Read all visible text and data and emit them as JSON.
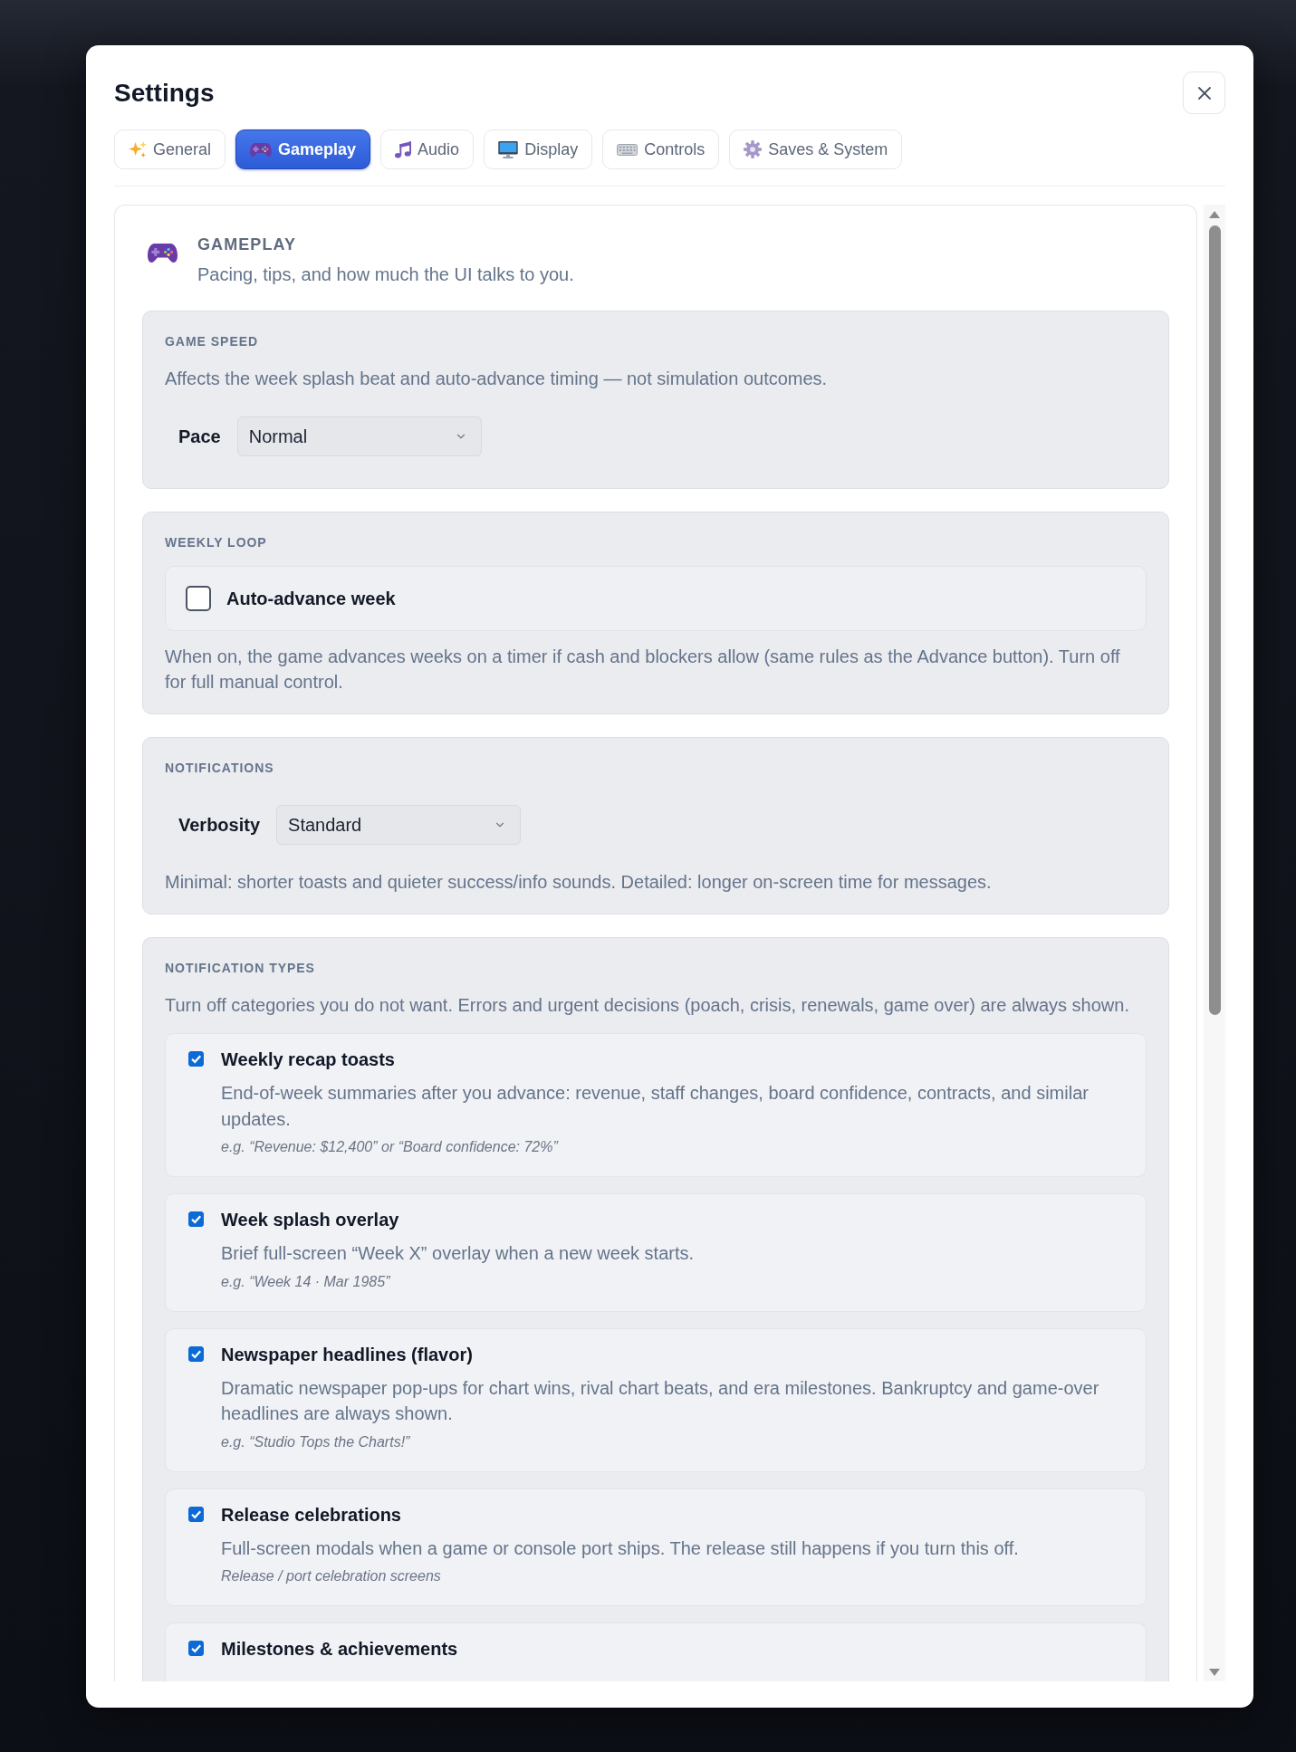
{
  "window": {
    "title": "Settings"
  },
  "tabs": [
    {
      "label": "General",
      "selected": false
    },
    {
      "label": "Gameplay",
      "selected": true
    },
    {
      "label": "Audio",
      "selected": false
    },
    {
      "label": "Display",
      "selected": false
    },
    {
      "label": "Controls",
      "selected": false
    },
    {
      "label": "Saves & System",
      "selected": false
    }
  ],
  "panel": {
    "title": "GAMEPLAY",
    "subtitle": "Pacing, tips, and how much the UI talks to you.",
    "sections": [
      {
        "kind": "select",
        "label": "GAME SPEED",
        "description": "Affects the week splash beat and auto-advance timing — not simulation outcomes.",
        "field": {
          "label": "Pace",
          "value": "Normal"
        }
      },
      {
        "kind": "toggle",
        "label": "WEEKLY LOOP",
        "option": {
          "label": "Auto-advance week",
          "checked": false
        },
        "note": "When on, the game advances weeks on a timer if cash and blockers allow (same rules as the Advance button). Turn off for full manual control."
      },
      {
        "kind": "select",
        "label": "NOTIFICATIONS",
        "field": {
          "label": "Verbosity",
          "value": "Standard"
        },
        "note": "Minimal: shorter toasts and quieter success/info sounds. Detailed: longer on-screen time for messages."
      },
      {
        "kind": "list",
        "label": "NOTIFICATION TYPES",
        "description": "Turn off categories you do not want. Errors and urgent decisions (poach, crisis, renewals, game over) are always shown.",
        "items": [
          {
            "title": "Weekly recap toasts",
            "checked": true,
            "description": "End-of-week summaries after you advance: revenue, staff changes, board confidence, contracts, and similar updates.",
            "example": "e.g. “Revenue: $12,400” or “Board confidence: 72%”"
          },
          {
            "title": "Week splash overlay",
            "checked": true,
            "description": "Brief full-screen “Week X” overlay when a new week starts.",
            "example": "e.g. “Week 14 · Mar 1985”"
          },
          {
            "title": "Newspaper headlines (flavor)",
            "checked": true,
            "description": "Dramatic newspaper pop-ups for chart wins, rival chart beats, and era milestones. Bankruptcy and game-over headlines are always shown.",
            "example": "e.g. “Studio Tops the Charts!”"
          },
          {
            "title": "Release celebrations",
            "checked": true,
            "description": "Full-screen modals when a game or console port ships. The release still happens if you turn this off.",
            "example": "Release / port celebration screens"
          },
          {
            "title": "Milestones & achievements",
            "checked": true
          }
        ]
      }
    ]
  }
}
